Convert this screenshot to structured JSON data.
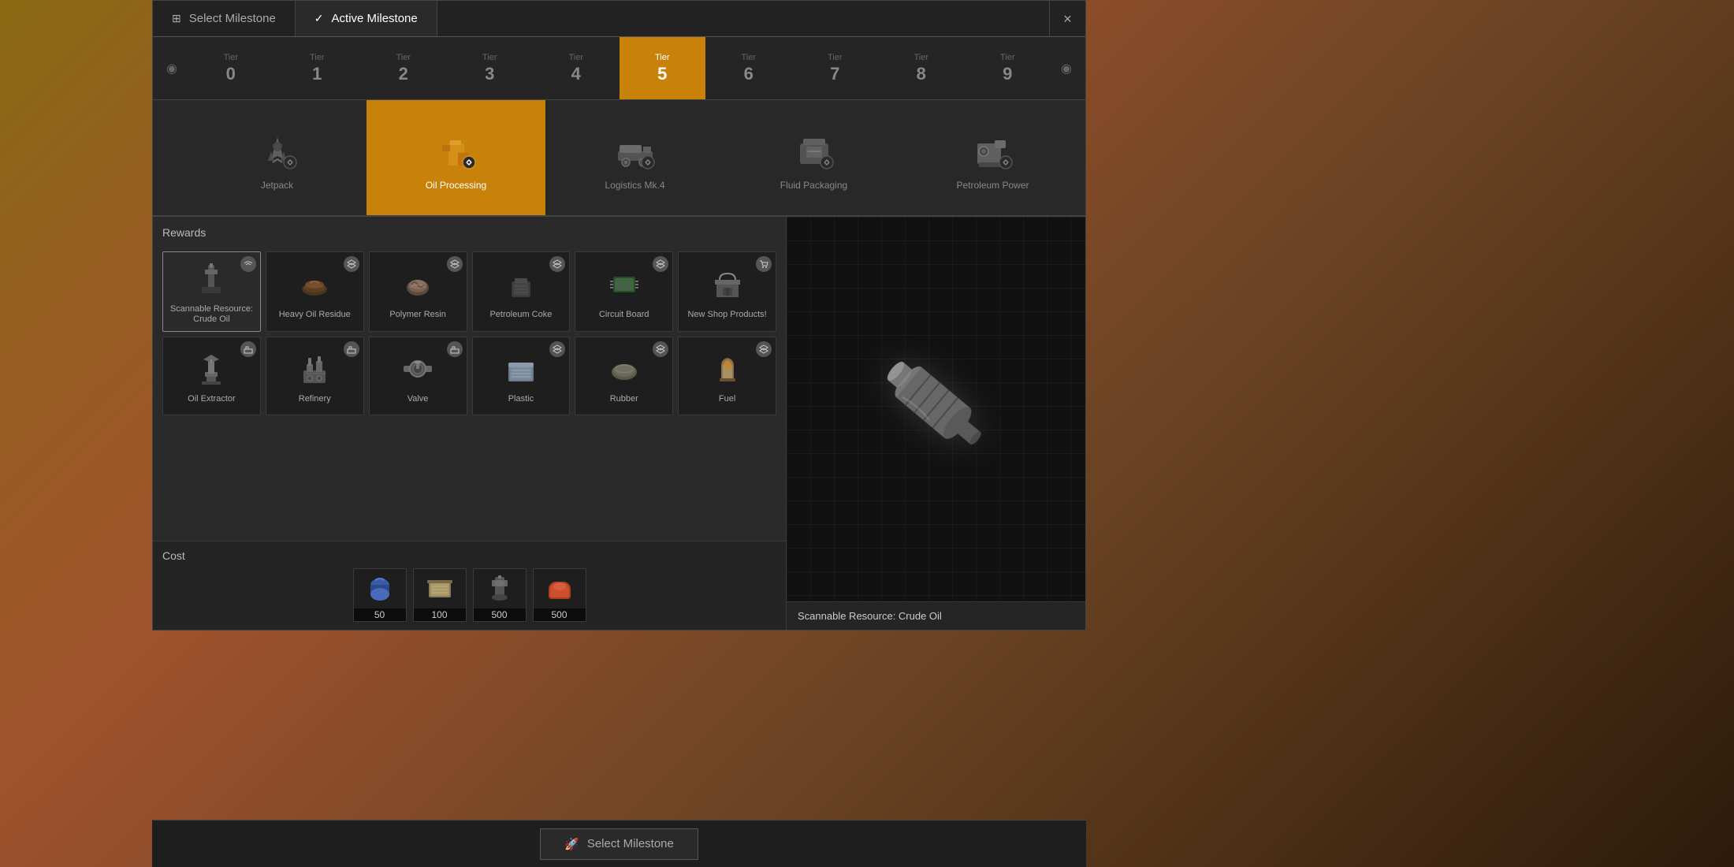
{
  "tabs": [
    {
      "id": "select",
      "label": "Select Milestone",
      "icon": "⊞",
      "active": false
    },
    {
      "id": "active",
      "label": "Active Milestone",
      "icon": "✓",
      "active": true
    }
  ],
  "close_btn": "×",
  "tiers": [
    {
      "label": "Tier",
      "num": "0",
      "active": false
    },
    {
      "label": "Tier",
      "num": "1",
      "active": false
    },
    {
      "label": "Tier",
      "num": "2",
      "active": false
    },
    {
      "label": "Tier",
      "num": "3",
      "active": false
    },
    {
      "label": "Tier",
      "num": "4",
      "active": false
    },
    {
      "label": "Tier",
      "num": "5",
      "active": true
    },
    {
      "label": "Tier",
      "num": "6",
      "active": false
    },
    {
      "label": "Tier",
      "num": "7",
      "active": false
    },
    {
      "label": "Tier",
      "num": "8",
      "active": false
    },
    {
      "label": "Tier",
      "num": "9",
      "active": false
    }
  ],
  "milestones": [
    {
      "name": "",
      "active": false,
      "empty": true
    },
    {
      "name": "Jetpack",
      "active": false,
      "icon": "✈"
    },
    {
      "name": "Oil Processing",
      "active": true,
      "icon": "⚙"
    },
    {
      "name": "Logistics Mk.4",
      "active": false,
      "icon": "🚂"
    },
    {
      "name": "Fluid Packaging",
      "active": false,
      "icon": "⚙"
    },
    {
      "name": "Petroleum Power",
      "active": false,
      "icon": "⚡"
    }
  ],
  "rewards_title": "Rewards",
  "rewards_row1": [
    {
      "name": "Scannable Resource: Crude Oil",
      "badge_type": "wifi",
      "selected": true
    },
    {
      "name": "Heavy Oil Residue",
      "badge_type": "layers",
      "selected": false
    },
    {
      "name": "Polymer Resin",
      "badge_type": "layers",
      "selected": false
    },
    {
      "name": "Petroleum Coke",
      "badge_type": "layers",
      "selected": false
    },
    {
      "name": "Circuit Board",
      "badge_type": "layers",
      "selected": false
    },
    {
      "name": "New Shop Products!",
      "badge_type": "cart",
      "selected": false
    }
  ],
  "rewards_row2": [
    {
      "name": "Oil Extractor",
      "badge_type": "factory",
      "selected": false
    },
    {
      "name": "Refinery",
      "badge_type": "factory",
      "selected": false
    },
    {
      "name": "Valve",
      "badge_type": "factory",
      "selected": false
    },
    {
      "name": "Plastic",
      "badge_type": "layers",
      "selected": false
    },
    {
      "name": "Rubber",
      "badge_type": "layers",
      "selected": false
    },
    {
      "name": "Fuel",
      "badge_type": "layers",
      "selected": false
    }
  ],
  "cost_title": "Cost",
  "cost_items": [
    {
      "amount": "50",
      "color": "#4a7aff"
    },
    {
      "amount": "100",
      "color": "#c8a96e"
    },
    {
      "amount": "500",
      "color": "#555"
    },
    {
      "amount": "500",
      "color": "#c86040"
    }
  ],
  "preview_label": "Scannable Resource: Crude Oil",
  "bottom_button": "Select Milestone",
  "bottom_icon": "🚀"
}
